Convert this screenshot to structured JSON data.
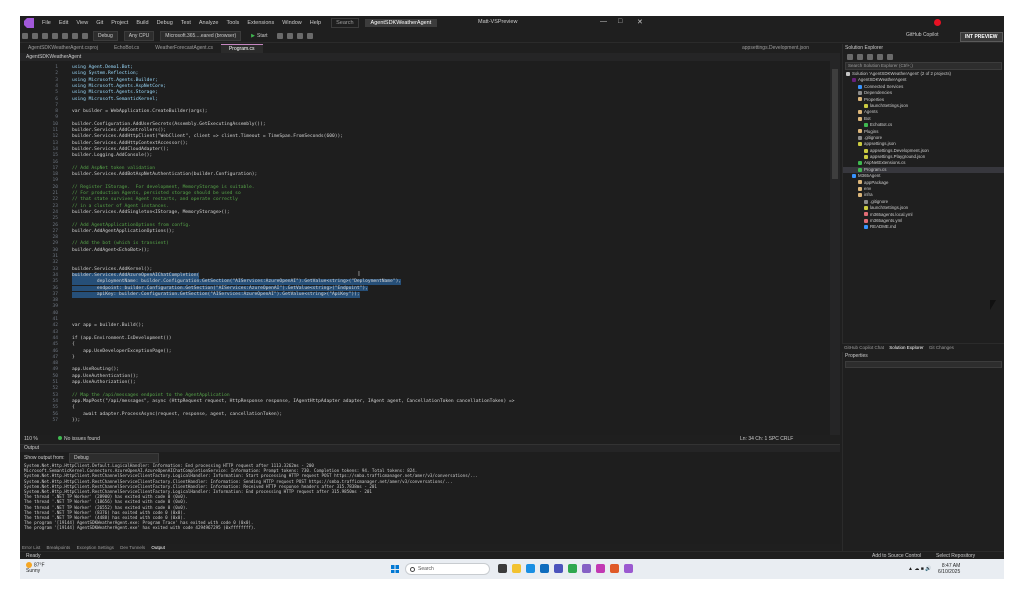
{
  "window": {
    "menu": [
      "File",
      "Edit",
      "View",
      "Git",
      "Project",
      "Build",
      "Debug",
      "Test",
      "Analyze",
      "Tools",
      "Extensions",
      "Window",
      "Help"
    ],
    "search": "Search",
    "solution_name": "AgentSDKWeatherAgent",
    "title": "Matt-VSPreview",
    "controls": {
      "minimize": "—",
      "maximize": "□",
      "close": "✕"
    }
  },
  "toolbar": {
    "config": "Debug",
    "platform": "Any CPU",
    "target": "Microsoft.365....eared (browser)",
    "start": "Start",
    "copilot": "GitHub Copilot",
    "preview": "INT PREVIEW"
  },
  "tabs": [
    {
      "label": "AgentSDKWeatherAgent.csproj"
    },
    {
      "label": "EchoBot.cs"
    },
    {
      "label": "WeatherForecastAgent.cs"
    },
    {
      "label": "Program.cs",
      "active": true
    }
  ],
  "tab_right": "appsettings.Development.json",
  "nav": "AgentSDKWeatherAgent",
  "code_lines": [
    {
      "n": "1",
      "t": "using Agent.Demo1.Bot;",
      "kind": "kw"
    },
    {
      "n": "2",
      "t": "using System.Reflection;",
      "kind": "kw"
    },
    {
      "n": "3",
      "t": "using Microsoft.Agents.Builder;",
      "kind": "kw"
    },
    {
      "n": "4",
      "t": "using Microsoft.Agents.AspNetCore;",
      "kind": "kw"
    },
    {
      "n": "5",
      "t": "using Microsoft.Agents.Storage;",
      "kind": "kw"
    },
    {
      "n": "6",
      "t": "using Microsoft.SemanticKernel;",
      "kind": "kw"
    },
    {
      "n": "7",
      "t": ""
    },
    {
      "n": "8",
      "t": "var builder = WebApplication.CreateBuilder(args);"
    },
    {
      "n": "9",
      "t": ""
    },
    {
      "n": "10",
      "t": "builder.Configuration.AddUserSecrets(Assembly.GetExecutingAssembly());"
    },
    {
      "n": "11",
      "t": "builder.Services.AddControllers();"
    },
    {
      "n": "12",
      "t": "builder.Services.AddHttpClient(\"WebClient\", client => client.Timeout = TimeSpan.FromSeconds(600));"
    },
    {
      "n": "13",
      "t": "builder.Services.AddHttpContextAccessor();"
    },
    {
      "n": "14",
      "t": "builder.Services.AddCloudAdapter();"
    },
    {
      "n": "15",
      "t": "builder.Logging.AddConsole();"
    },
    {
      "n": "16",
      "t": ""
    },
    {
      "n": "17",
      "t": "// Add AspNet token validation",
      "kind": "comment"
    },
    {
      "n": "18",
      "t": "builder.Services.AddBotAspNetAuthentication(builder.Configuration);"
    },
    {
      "n": "19",
      "t": ""
    },
    {
      "n": "20",
      "t": "// Register IStorage.  For development, MemoryStorage is suitable.",
      "kind": "comment"
    },
    {
      "n": "21",
      "t": "// For production Agents, persisted storage should be used so",
      "kind": "comment"
    },
    {
      "n": "22",
      "t": "// that state survives Agent restarts, and operate correctly",
      "kind": "comment"
    },
    {
      "n": "23",
      "t": "// in a cluster of Agent instances.",
      "kind": "comment"
    },
    {
      "n": "24",
      "t": "builder.Services.AddSingleton<IStorage, MemoryStorage>();"
    },
    {
      "n": "25",
      "t": ""
    },
    {
      "n": "26",
      "t": "// Add AgentApplicationOptions from config.",
      "kind": "comment"
    },
    {
      "n": "27",
      "t": "builder.AddAgentApplicationOptions();"
    },
    {
      "n": "28",
      "t": ""
    },
    {
      "n": "29",
      "t": "// Add the bot (which is transient)",
      "kind": "comment"
    },
    {
      "n": "30",
      "t": "builder.AddAgent<EchoBot>();"
    },
    {
      "n": "31",
      "t": ""
    },
    {
      "n": "32",
      "t": ""
    },
    {
      "n": "33",
      "t": "builder.Services.AddKernel();"
    },
    {
      "n": "34",
      "t": "builder.Services.AddAzureOpenAIChatCompletion(",
      "kind": "sel"
    },
    {
      "n": "35",
      "t": "         deploymentName: builder.Configuration.GetSection(\"AIServices:AzureOpenAI\").GetValue<string>(\"DeploymentName\"),",
      "kind": "sel"
    },
    {
      "n": "36",
      "t": "         endpoint: builder.Configuration.GetSection(\"AIServices:AzureOpenAI\").GetValue<string>(\"Endpoint\"),",
      "kind": "sel"
    },
    {
      "n": "37",
      "t": "         apiKey: builder.Configuration.GetSection(\"AIServices:AzureOpenAI\").GetValue<string>(\"ApiKey\"));",
      "kind": "sel"
    },
    {
      "n": "38",
      "t": ""
    },
    {
      "n": "39",
      "t": ""
    },
    {
      "n": "40",
      "t": ""
    },
    {
      "n": "41",
      "t": ""
    },
    {
      "n": "42",
      "t": "var app = builder.Build();"
    },
    {
      "n": "43",
      "t": ""
    },
    {
      "n": "44",
      "t": "if (app.Environment.IsDevelopment())"
    },
    {
      "n": "45",
      "t": "{"
    },
    {
      "n": "46",
      "t": "    app.UseDeveloperExceptionPage();"
    },
    {
      "n": "47",
      "t": "}"
    },
    {
      "n": "48",
      "t": ""
    },
    {
      "n": "49",
      "t": "app.UseRouting();"
    },
    {
      "n": "50",
      "t": "app.UseAuthentication();"
    },
    {
      "n": "51",
      "t": "app.UseAuthorization();"
    },
    {
      "n": "52",
      "t": ""
    },
    {
      "n": "53",
      "t": "// Map the /api/messages endpoint to the AgentApplication",
      "kind": "comment"
    },
    {
      "n": "54",
      "t": "app.MapPost(\"/api/messages\", async (HttpRequest request, HttpResponse response, IAgentHttpAdapter adapter, IAgent agent, CancellationToken cancellationToken) =>"
    },
    {
      "n": "55",
      "t": "{"
    },
    {
      "n": "56",
      "t": "    await adapter.ProcessAsync(request, response, agent, cancellationToken);"
    },
    {
      "n": "57",
      "t": "});"
    }
  ],
  "editor_status": {
    "zoom": "110 %",
    "issues": "No issues found",
    "position": "Ln: 34   Ch: 1   SPC   CRLF"
  },
  "output": {
    "title": "Output",
    "show_from_label": "Show output from:",
    "show_from_value": "Debug",
    "lines": [
      "System.Net.Http.HttpClient.Default.LogicalHandler: Information: End processing HTTP request after 1113.3262ms - 200",
      "Microsoft.SemanticKernel.Connectors.AzureOpenAI.AzureOpenAIChatCompletionService: Information: Prompt tokens: 730. Completion tokens: 94. Total tokens: 824.",
      "System.Net.Http.HttpClient.RestChannelServiceClientFactory.LogicalHandler: Information: Start processing HTTP request POST https://smba.trafficmanager.net/amer/v3/conversations/...",
      "System.Net.Http.HttpClient.RestChannelServiceClientFactory.ClientHandler: Information: Sending HTTP request POST https://smba.trafficmanager.net/amer/v3/conversations/...",
      "System.Net.Http.HttpClient.RestChannelServiceClientFactory.ClientHandler: Information: Received HTTP response headers after 315.7838ms - 201",
      "System.Net.Http.HttpClient.RestChannelServiceClientFactory.LogicalHandler: Information: End processing HTTP request after 315.9850ms - 201",
      "The thread '.NET TP Worker' (28900) has exited with code 0 (0x0).",
      "The thread '.NET TP Worker' (18656) has exited with code 0 (0x0).",
      "The thread '.NET TP Worker' (26552) has exited with code 0 (0x0).",
      "The thread '.NET TP Worker' (8376) has exited with code 0 (0x0).",
      "The thread '.NET TP Worker' (4488) has exited with code 0 (0x0).",
      "The program '[19144] AgentSDKWeatherAgent.exe: Program Trace' has exited with code 0 (0x0).",
      "The program '[19144] AgentSDKWeatherAgent.exe' has exited with code 4294967295 (0xffffffff)."
    ]
  },
  "bottom_tabs": [
    {
      "label": "Error List"
    },
    {
      "label": "Breakpoints"
    },
    {
      "label": "Exception Settings"
    },
    {
      "label": "Dev Tunnels"
    },
    {
      "label": "Output",
      "active": true
    }
  ],
  "statusbar": {
    "ready": "Ready",
    "source_control": "Add to Source Control",
    "repository": "Select Repository"
  },
  "solution_explorer": {
    "title": "Solution Explorer",
    "search_placeholder": "Search Solution Explorer (Ctrl+;)",
    "items": [
      {
        "label": "Solution 'AgentSDKWeatherAgent' (2 of 2 projects)",
        "depth": 0,
        "color": "#c5c5c5"
      },
      {
        "label": "AgentSDKWeatherAgent",
        "depth": 1,
        "color": "#68217a"
      },
      {
        "label": "Connected Services",
        "depth": 2,
        "color": "#3794ff"
      },
      {
        "label": "Dependencies",
        "depth": 2,
        "color": "#8c8c8c"
      },
      {
        "label": "Properties",
        "depth": 2,
        "color": "#dcb67a"
      },
      {
        "label": "launchSettings.json",
        "depth": 3,
        "color": "#cbcb41"
      },
      {
        "label": "Agents",
        "depth": 2,
        "color": "#dcb67a"
      },
      {
        "label": "Bot",
        "depth": 2,
        "color": "#dcb67a"
      },
      {
        "label": "EchoBot.cs",
        "depth": 3,
        "color": "#3fb950"
      },
      {
        "label": "Plugins",
        "depth": 2,
        "color": "#dcb67a"
      },
      {
        "label": ".gitignore",
        "depth": 2,
        "color": "#8c8c8c"
      },
      {
        "label": "appsettings.json",
        "depth": 2,
        "color": "#cbcb41"
      },
      {
        "label": "appsettings.Development.json",
        "depth": 3,
        "color": "#cbcb41"
      },
      {
        "label": "appsettings.Playground.json",
        "depth": 3,
        "color": "#cbcb41"
      },
      {
        "label": "AspNetExtensions.cs",
        "depth": 2,
        "color": "#3fb950"
      },
      {
        "label": "Program.cs",
        "depth": 2,
        "color": "#3fb950",
        "selected": true
      },
      {
        "label": "M365Agent",
        "depth": 1,
        "color": "#3794ff"
      },
      {
        "label": "appPackage",
        "depth": 2,
        "color": "#dcb67a"
      },
      {
        "label": "env",
        "depth": 2,
        "color": "#dcb67a"
      },
      {
        "label": "infra",
        "depth": 2,
        "color": "#dcb67a"
      },
      {
        "label": ".gitignore",
        "depth": 3,
        "color": "#8c8c8c"
      },
      {
        "label": "launchSettings.json",
        "depth": 3,
        "color": "#cbcb41"
      },
      {
        "label": "m365agents.local.yml",
        "depth": 3,
        "color": "#e06c75"
      },
      {
        "label": "m365agents.yml",
        "depth": 3,
        "color": "#e06c75"
      },
      {
        "label": "README.md",
        "depth": 3,
        "color": "#3794ff"
      }
    ],
    "tabs": [
      {
        "label": "GitHub Copilot Chat"
      },
      {
        "label": "Solution Explorer",
        "active": true
      },
      {
        "label": "Git Changes"
      }
    ]
  },
  "properties": {
    "title": "Properties"
  },
  "taskbar": {
    "weather_temp": "87°F",
    "weather_desc": "Sunny",
    "search": "Search",
    "time": "8:47 AM",
    "date": "6/10/2025"
  }
}
